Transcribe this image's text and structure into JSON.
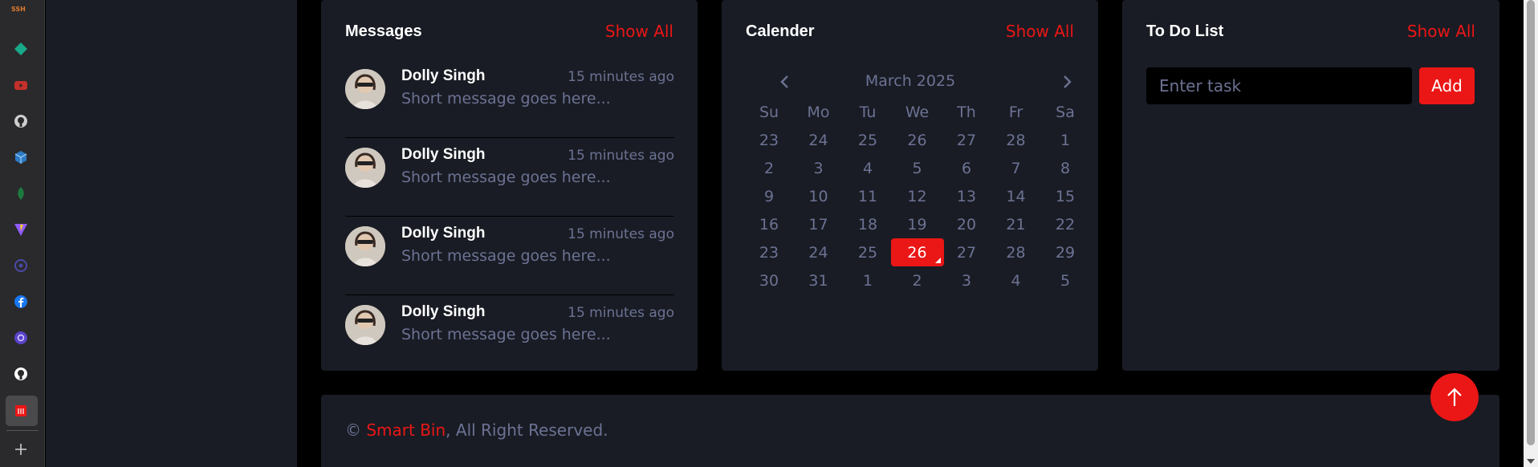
{
  "dock": {
    "top_label": "SSH",
    "icons": [
      "diamond-icon",
      "youtube-icon",
      "github-icon",
      "cube-icon",
      "leaf-icon",
      "vite-icon",
      "globe-icon",
      "facebook-icon",
      "shield-icon",
      "github-icon",
      "trash-icon",
      "plus-icon"
    ]
  },
  "messages": {
    "title": "Messages",
    "show_all": "Show All",
    "items": [
      {
        "name": "Dolly Singh",
        "time": "15 minutes ago",
        "text": "Short message goes here..."
      },
      {
        "name": "Dolly Singh",
        "time": "15 minutes ago",
        "text": "Short message goes here..."
      },
      {
        "name": "Dolly Singh",
        "time": "15 minutes ago",
        "text": "Short message goes here..."
      },
      {
        "name": "Dolly Singh",
        "time": "15 minutes ago",
        "text": "Short message goes here..."
      }
    ]
  },
  "calendar": {
    "title": "Calender",
    "show_all": "Show All",
    "month": "March 2025",
    "weekdays": [
      "Su",
      "Mo",
      "Tu",
      "We",
      "Th",
      "Fr",
      "Sa"
    ],
    "weeks": [
      [
        "23",
        "24",
        "25",
        "26",
        "27",
        "28",
        "1"
      ],
      [
        "2",
        "3",
        "4",
        "5",
        "6",
        "7",
        "8"
      ],
      [
        "9",
        "10",
        "11",
        "12",
        "13",
        "14",
        "15"
      ],
      [
        "16",
        "17",
        "18",
        "19",
        "20",
        "21",
        "22"
      ],
      [
        "23",
        "24",
        "25",
        "26",
        "27",
        "28",
        "29"
      ],
      [
        "30",
        "31",
        "1",
        "2",
        "3",
        "4",
        "5"
      ]
    ],
    "selected_day": "26"
  },
  "todo": {
    "title": "To Do List",
    "show_all": "Show All",
    "placeholder": "Enter task",
    "add_label": "Add"
  },
  "footer": {
    "copyright": "©",
    "brand": "Smart Bin",
    "rights": ", All Right Reserved."
  },
  "colors": {
    "accent": "#eb1616",
    "card_bg": "#191c24",
    "muted_text": "#6c7293",
    "page_bg": "#000000"
  }
}
